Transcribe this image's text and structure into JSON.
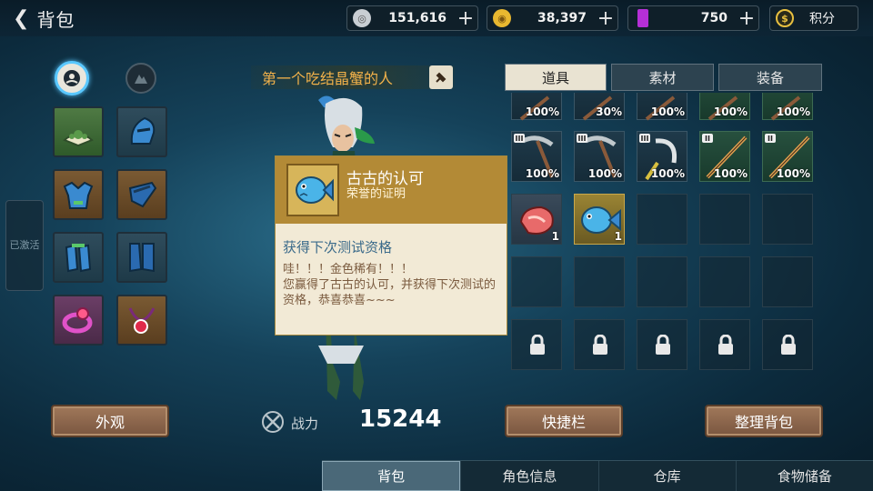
{
  "header": {
    "title": "背包"
  },
  "currencies": [
    {
      "icon": "silver-coin-icon",
      "value": "151,616",
      "has_plus": true
    },
    {
      "icon": "gold-coin-icon",
      "value": "38,397",
      "has_plus": true
    },
    {
      "icon": "purple-crystal-icon",
      "value": "750",
      "has_plus": true
    },
    {
      "icon": "points-icon",
      "value": "积分",
      "has_plus": false
    }
  ],
  "left_panel": {
    "activated_label": "已激活",
    "char_tabs": [
      "face-badge-icon",
      "mountain-badge-icon"
    ]
  },
  "title_banner": "第一个吃结晶蟹的人",
  "tooltip": {
    "name": "古古的认可",
    "subtitle": "荣誉的证明",
    "section_title": "获得下次测试资格",
    "description": "哇！！！金色稀有！！！\n您赢得了古古的认可，并获得下次测试的资格，恭喜恭喜~~~"
  },
  "inventory_tabs": [
    {
      "label": "道具",
      "active": true
    },
    {
      "label": "素材",
      "active": false
    },
    {
      "label": "装备",
      "active": false
    }
  ],
  "inventory": {
    "row0": [
      "100%",
      "30%",
      "100%",
      "100%",
      "100%"
    ],
    "row1": [
      {
        "tier": "III",
        "pct": "100%",
        "icon": "pickaxe-icon"
      },
      {
        "tier": "III",
        "pct": "100%",
        "icon": "pickaxe-icon"
      },
      {
        "tier": "III",
        "pct": "100%",
        "icon": "sickle-icon"
      },
      {
        "tier": "II",
        "pct": "100%",
        "icon": "fishing-rod-icon"
      },
      {
        "tier": "II",
        "pct": "100%",
        "icon": "fishing-rod-icon"
      }
    ],
    "row2": [
      {
        "count": "1",
        "icon": "meat-icon"
      },
      {
        "count": "1",
        "icon": "fish-icon"
      }
    ]
  },
  "buttons": {
    "appearance": "外观",
    "quickbar": "快捷栏",
    "sort": "整理背包"
  },
  "power": {
    "label": "战力",
    "value": "15244"
  },
  "bottom_nav": [
    {
      "label": "背包",
      "active": true
    },
    {
      "label": "角色信息",
      "active": false
    },
    {
      "label": "仓库",
      "active": false
    },
    {
      "label": "食物储备",
      "active": false
    }
  ],
  "colors": {
    "accent_gold": "#f3b24a",
    "tooltip_header": "#b38a36",
    "tooltip_section": "#3a6a8a"
  }
}
